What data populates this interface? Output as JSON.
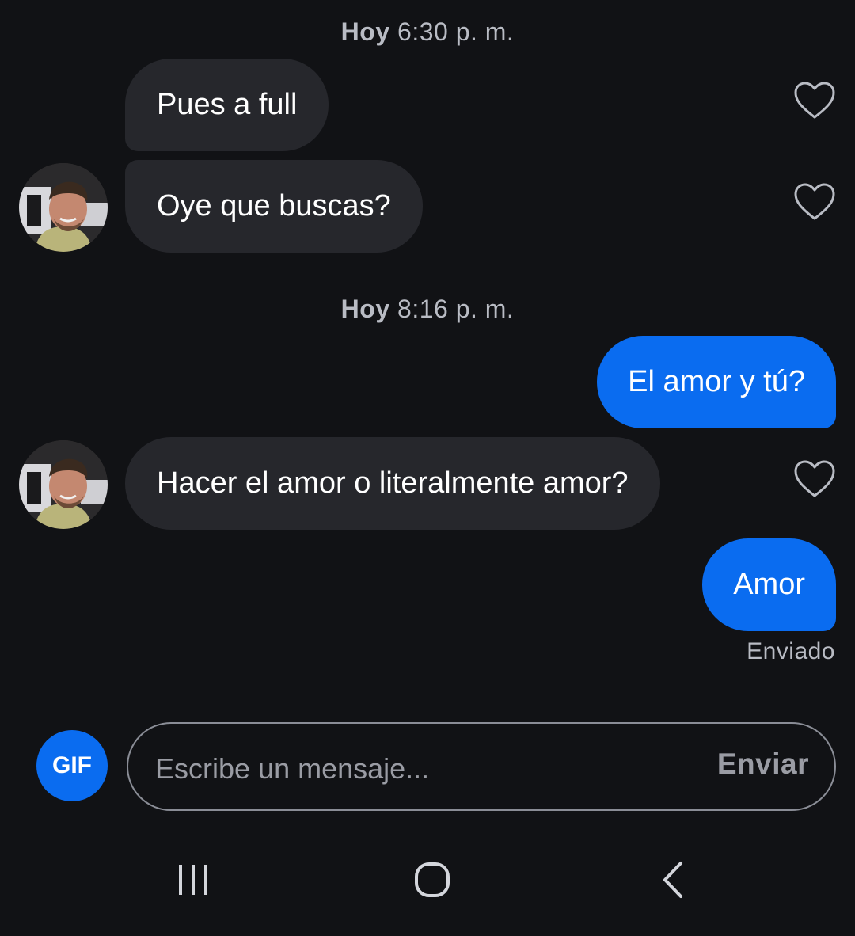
{
  "conversation": {
    "timestamps": [
      {
        "day": "Hoy",
        "time": "6:30 p. m."
      },
      {
        "day": "Hoy",
        "time": "8:16 p. m."
      }
    ],
    "messages": [
      {
        "text": "Pues a full",
        "direction": "incoming"
      },
      {
        "text": "Oye que buscas?",
        "direction": "incoming"
      },
      {
        "text": "El amor y tú?",
        "direction": "outgoing"
      },
      {
        "text": "Hacer el amor o literalmente amor?",
        "direction": "incoming"
      },
      {
        "text": "Amor",
        "direction": "outgoing"
      }
    ],
    "status": "Enviado"
  },
  "composer": {
    "gif_label": "GIF",
    "placeholder": "Escribe un mensaje...",
    "send_label": "Enviar"
  },
  "icons": {
    "like": "heart-icon",
    "recents": "recent-apps-icon",
    "home": "home-icon",
    "back": "back-icon"
  },
  "colors": {
    "background": "#111215",
    "incoming_bubble": "#26272c",
    "outgoing_bubble": "#0a6cf0",
    "accent": "#0a6cf0",
    "muted_text": "#b9bcc4"
  }
}
